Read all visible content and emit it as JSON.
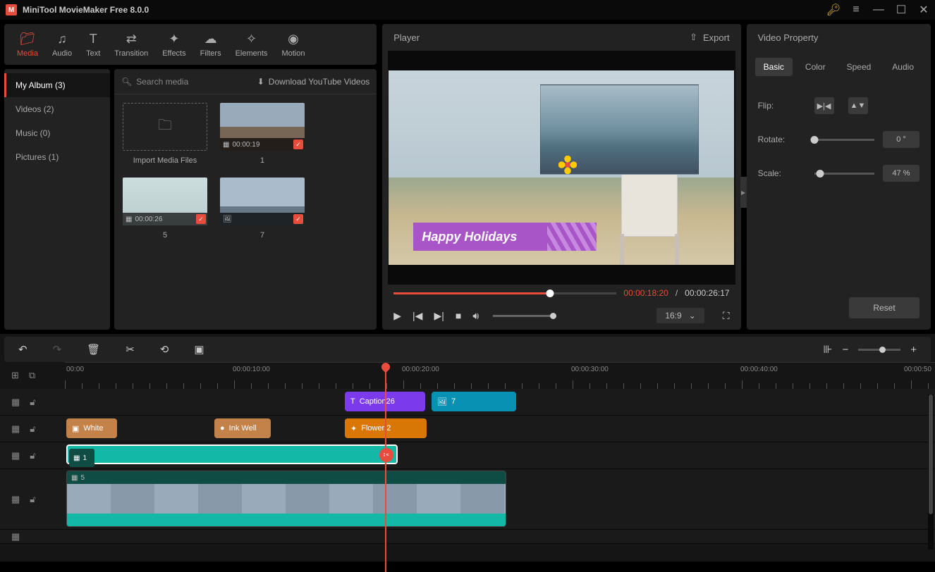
{
  "app": {
    "title": "MiniTool MovieMaker Free 8.0.0"
  },
  "toolbar": {
    "items": [
      {
        "label": "Media",
        "icon": "folder"
      },
      {
        "label": "Audio",
        "icon": "music"
      },
      {
        "label": "Text",
        "icon": "text"
      },
      {
        "label": "Transition",
        "icon": "transition"
      },
      {
        "label": "Effects",
        "icon": "effects"
      },
      {
        "label": "Filters",
        "icon": "filters"
      },
      {
        "label": "Elements",
        "icon": "elements"
      },
      {
        "label": "Motion",
        "icon": "motion"
      }
    ]
  },
  "sidebar": {
    "items": [
      {
        "label": "My Album (3)"
      },
      {
        "label": "Videos (2)"
      },
      {
        "label": "Music (0)"
      },
      {
        "label": "Pictures (1)"
      }
    ]
  },
  "media": {
    "search_placeholder": "Search media",
    "ytdl_label": "Download YouTube Videos",
    "import_label": "Import Media Files",
    "items": [
      {
        "duration": "00:00:19",
        "label": "1",
        "type": "video"
      },
      {
        "duration": "00:00:26",
        "label": "5",
        "type": "video"
      },
      {
        "label": "7",
        "type": "image"
      }
    ]
  },
  "player": {
    "title": "Player",
    "export_label": "Export",
    "caption_text": "Happy Holidays",
    "time_current": "00:00:18:20",
    "time_total": "00:00:26:17",
    "aspect": "16:9"
  },
  "props": {
    "title": "Video Property",
    "tabs": [
      "Basic",
      "Color",
      "Speed",
      "Audio"
    ],
    "flip_label": "Flip:",
    "rotate_label": "Rotate:",
    "rotate_value": "0 °",
    "scale_label": "Scale:",
    "scale_value": "47 %",
    "reset_label": "Reset"
  },
  "timeline": {
    "marks": [
      "00:00",
      "00:00:10:00",
      "00:00:20:00",
      "00:00:30:00",
      "00:00:40:00",
      "00:00:50"
    ],
    "clips": {
      "caption": "Caption26",
      "pip": "7",
      "white": "White",
      "ink": "Ink Well",
      "flower": "Flower 2",
      "video1": "1",
      "video5": "5"
    }
  }
}
